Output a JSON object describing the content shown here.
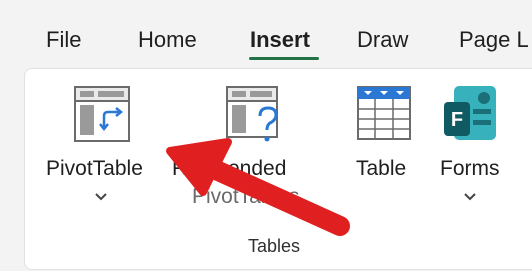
{
  "tabs": [
    {
      "label": "File"
    },
    {
      "label": "Home"
    },
    {
      "label": "Insert",
      "active": true
    },
    {
      "label": "Draw"
    },
    {
      "label": "Page L"
    }
  ],
  "ribbon": {
    "group_label": "Tables",
    "commands": [
      {
        "line1": "PivotTable",
        "icon": "pivottable-icon",
        "has_dropdown": true
      },
      {
        "line1": "Recommended",
        "line2": "PivotTables",
        "visible_line1": "R    mmended",
        "icon": "recommended-pivottables-icon"
      },
      {
        "line1": "Table",
        "icon": "table-icon"
      },
      {
        "line1": "Forms",
        "icon": "forms-icon",
        "has_dropdown": true
      }
    ]
  },
  "colors": {
    "accent_underline": "#217346",
    "annotation_arrow": "#e02020",
    "table_blue": "#2b78d4",
    "forms_teal": "#1b6f79"
  }
}
